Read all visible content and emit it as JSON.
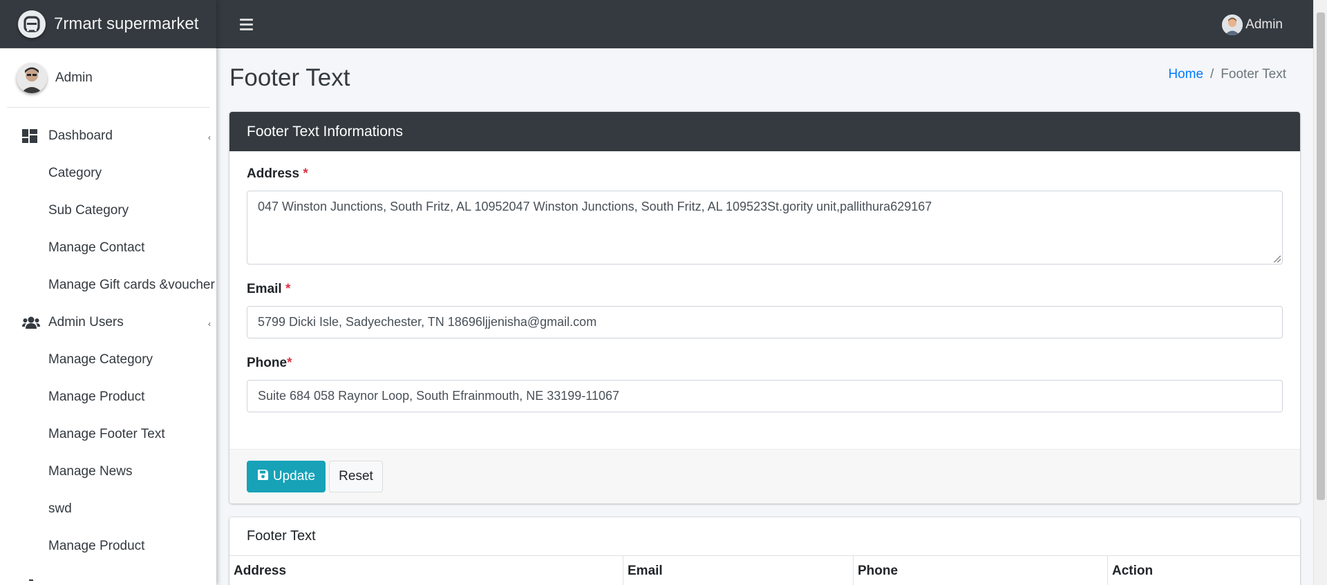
{
  "brand": {
    "name": "7rmart supermarket",
    "logo_icon": "brand-logo-icon"
  },
  "sidebar": {
    "user_name": "Admin",
    "items": [
      {
        "label": "Dashboard",
        "type": "parent",
        "icon": "dashboard-icon",
        "has_caret": true
      },
      {
        "label": "Category",
        "type": "child"
      },
      {
        "label": "Sub Category",
        "type": "child"
      },
      {
        "label": "Manage Contact",
        "type": "child"
      },
      {
        "label": "Manage Gift cards &voucher",
        "type": "child"
      },
      {
        "label": "Admin Users",
        "type": "parent",
        "icon": "users-icon",
        "has_caret": true
      },
      {
        "label": "Manage Category",
        "type": "child"
      },
      {
        "label": "Manage Product",
        "type": "child"
      },
      {
        "label": "Manage Footer Text",
        "type": "child"
      },
      {
        "label": "Manage News",
        "type": "child"
      },
      {
        "label": "swd",
        "type": "child"
      },
      {
        "label": "Manage Product",
        "type": "child"
      }
    ]
  },
  "header": {
    "user_name": "Admin"
  },
  "page": {
    "title": "Footer Text",
    "breadcrumb": {
      "home": "Home",
      "separator": "/",
      "current": "Footer Text"
    }
  },
  "form": {
    "header": "Footer Text Informations",
    "address": {
      "label": "Address",
      "required": "*",
      "value": "047 Winston Junctions, South Fritz, AL 10952047 Winston Junctions, South Fritz, AL 109523St.gority unit,pallithura629167"
    },
    "email": {
      "label": "Email",
      "required": "*",
      "value": "5799 Dicki Isle, Sadyechester, TN 18696ljjenisha@gmail.com"
    },
    "phone": {
      "label": "Phone",
      "required": "*",
      "value": "Suite 684 058 Raynor Loop, South Efrainmouth, NE 33199-11067"
    },
    "update_label": "Update",
    "reset_label": "Reset"
  },
  "table": {
    "title": "Footer Text",
    "columns": [
      "Address",
      "Email",
      "Phone",
      "Action"
    ]
  },
  "colors": {
    "dark": "#343a40",
    "accent": "#17a2b8",
    "link": "#007bff",
    "required": "#dc3545"
  }
}
